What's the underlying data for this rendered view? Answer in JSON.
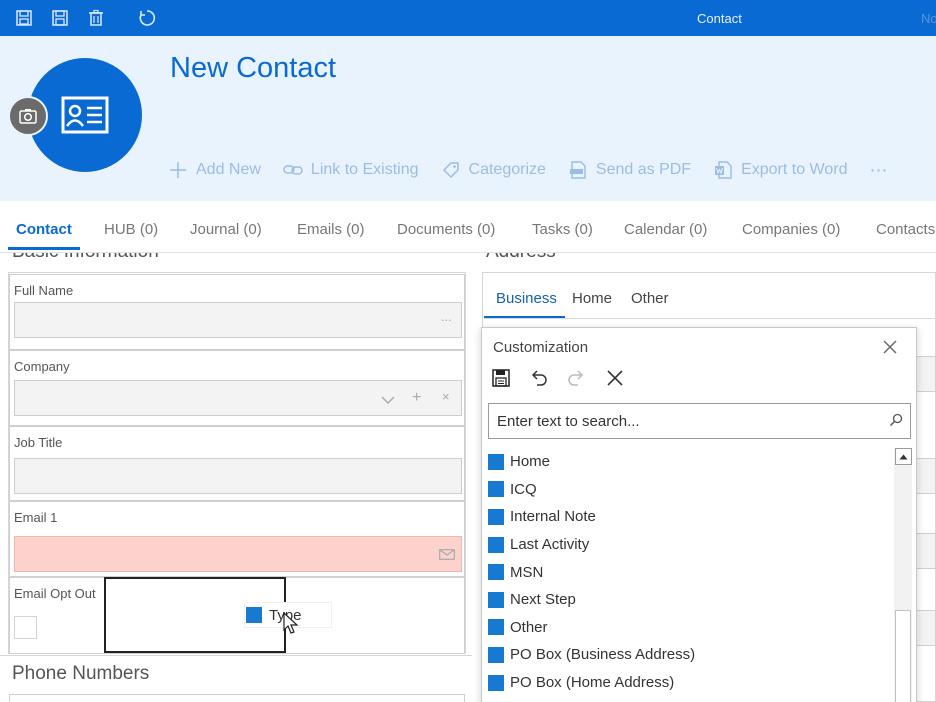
{
  "topbar": {
    "title": "Contact",
    "user_partial": "No",
    "colors": {
      "bar": "#0a6ad4"
    },
    "icons": [
      "save-icon",
      "save-close-icon",
      "delete-icon",
      "refresh-icon"
    ]
  },
  "header": {
    "title": "New Contact",
    "actions": [
      {
        "label": "Add New",
        "icon": "plus-icon"
      },
      {
        "label": "Link to Existing",
        "icon": "link-icon"
      },
      {
        "label": "Categorize",
        "icon": "tag-icon"
      },
      {
        "label": "Send as PDF",
        "icon": "pdf-icon"
      },
      {
        "label": "Export to Word",
        "icon": "word-icon"
      }
    ],
    "more": "⋯"
  },
  "tabs": [
    {
      "label": "Contact",
      "active": true
    },
    {
      "label": "HUB (0)"
    },
    {
      "label": "Journal (0)"
    },
    {
      "label": "Emails (0)"
    },
    {
      "label": "Documents (0)"
    },
    {
      "label": "Tasks (0)"
    },
    {
      "label": "Calendar (0)"
    },
    {
      "label": "Companies (0)"
    },
    {
      "label": "Contacts"
    }
  ],
  "basic": {
    "heading": "Basic Information",
    "fields": {
      "full_name": "Full Name",
      "company": "Company",
      "job_title": "Job Title",
      "email1": "Email 1",
      "email_opt_out": "Email Opt Out"
    },
    "full_name_ellipsis": "...",
    "company_add": "+",
    "company_clear": "×"
  },
  "drag_item": {
    "label": "Type"
  },
  "phone": {
    "heading": "Phone Numbers"
  },
  "address": {
    "heading": "Address",
    "tabs": [
      "Business",
      "Home",
      "Other"
    ]
  },
  "customization": {
    "title": "Customization",
    "search_placeholder": "Enter text to search...",
    "items": [
      "Home",
      "ICQ",
      "Internal Note",
      "Last Activity",
      "MSN",
      "Next Step",
      "Other",
      "PO Box (Business Address)",
      "PO Box (Home Address)"
    ],
    "item_color": "#1879d0"
  }
}
